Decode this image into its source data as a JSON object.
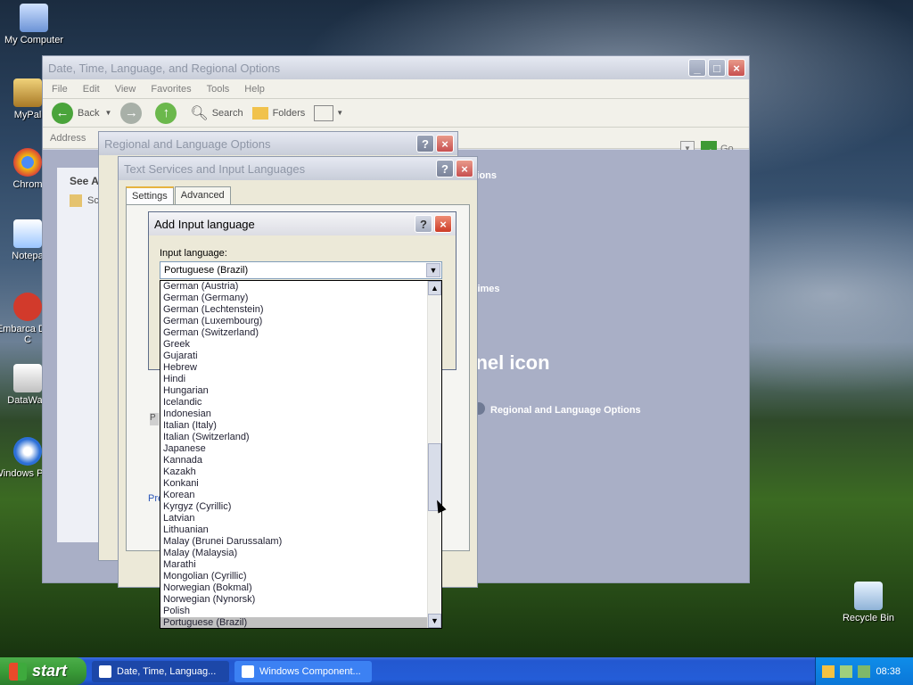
{
  "desktop": {
    "icons": [
      {
        "label": "My Computer"
      },
      {
        "label": "MyPal"
      },
      {
        "label": "Chrom"
      },
      {
        "label": "Notepa"
      },
      {
        "label": "Embarca Dev-C"
      },
      {
        "label": "DataWag"
      },
      {
        "label": "Windows Playe"
      },
      {
        "label": "Recycle Bin"
      }
    ]
  },
  "main_window": {
    "title": "Date, Time, Language, and Regional Options",
    "menu": [
      "File",
      "Edit",
      "View",
      "Favorites",
      "Tools",
      "Help"
    ],
    "toolbar": {
      "back": "Back",
      "search": "Search",
      "folders": "Folders"
    },
    "address_label": "Address",
    "go_label": "Go",
    "see_also": "See A",
    "left_item": "Sc",
    "options_partial": "ptions",
    "times_partial": "d times",
    "heading_partial": "nnel icon",
    "rlo_link": "Regional and Language Options"
  },
  "regional_dialog": {
    "title": "Regional and Language Options"
  },
  "textsvc_dialog": {
    "title": "Text Services and Input Languages",
    "tabs": [
      "Settings",
      "Advanced"
    ],
    "pref_partial": "Pre",
    "p_partial": "P"
  },
  "add_dialog": {
    "title": "Add Input language",
    "input_label": "Input language:",
    "selected": "Portuguese (Brazil)",
    "options": [
      "German (Austria)",
      "German (Germany)",
      "German (Lechtenstein)",
      "German (Luxembourg)",
      "German (Switzerland)",
      "Greek",
      "Gujarati",
      "Hebrew",
      "Hindi",
      "Hungarian",
      "Icelandic",
      "Indonesian",
      "Italian (Italy)",
      "Italian (Switzerland)",
      "Japanese",
      "Kannada",
      "Kazakh",
      "Konkani",
      "Korean",
      "Kyrgyz (Cyrillic)",
      "Latvian",
      "Lithuanian",
      "Malay (Brunei Darussalam)",
      "Malay (Malaysia)",
      "Marathi",
      "Mongolian (Cyrillic)",
      "Norwegian (Bokmal)",
      "Norwegian (Nynorsk)",
      "Polish",
      "Portuguese (Brazil)"
    ]
  },
  "taskbar": {
    "start": "start",
    "tasks": [
      {
        "label": "Date, Time, Languag..."
      },
      {
        "label": "Windows Component..."
      }
    ],
    "clock": "08:38"
  }
}
